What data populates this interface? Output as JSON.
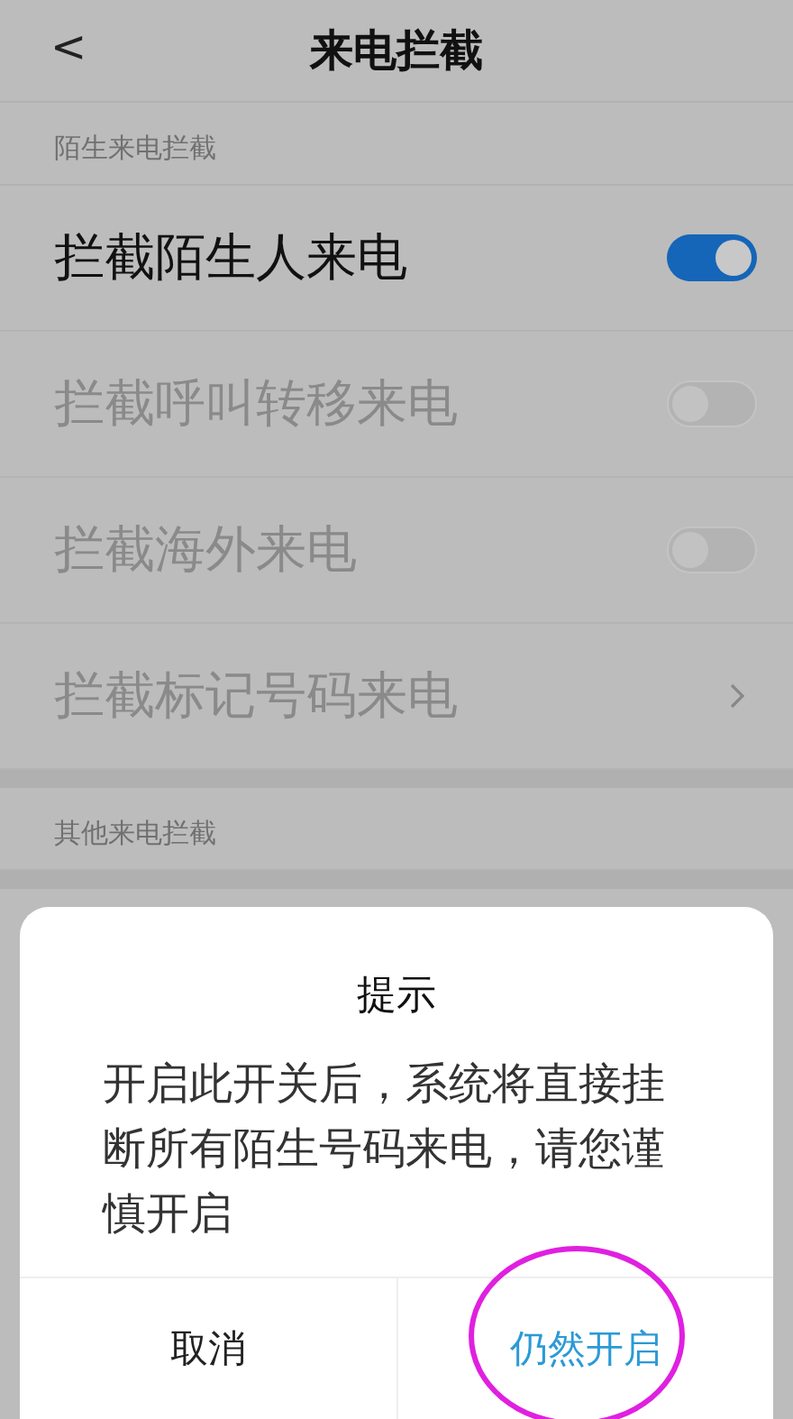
{
  "header": {
    "back": "<",
    "title": "来电拦截"
  },
  "sections": [
    {
      "title": "陌生来电拦截",
      "rows": [
        {
          "kind": "toggle",
          "label": "拦截陌生人来电",
          "on": true,
          "disabled": false
        },
        {
          "kind": "toggle",
          "label": "拦截呼叫转移来电",
          "on": false,
          "disabled": true
        },
        {
          "kind": "toggle",
          "label": "拦截海外来电",
          "on": false,
          "disabled": true
        },
        {
          "kind": "link",
          "label": "拦截标记号码来电",
          "disabled": true
        }
      ]
    },
    {
      "title": "其他来电拦截"
    }
  ],
  "dialog": {
    "title": "提示",
    "message": "开启此开关后，系统将直接挂断所有陌生号码来电，请您谨慎开启",
    "buttons": [
      {
        "label": "取消",
        "primary": false
      },
      {
        "label": "仍然开启",
        "primary": true,
        "circled": true
      }
    ]
  }
}
